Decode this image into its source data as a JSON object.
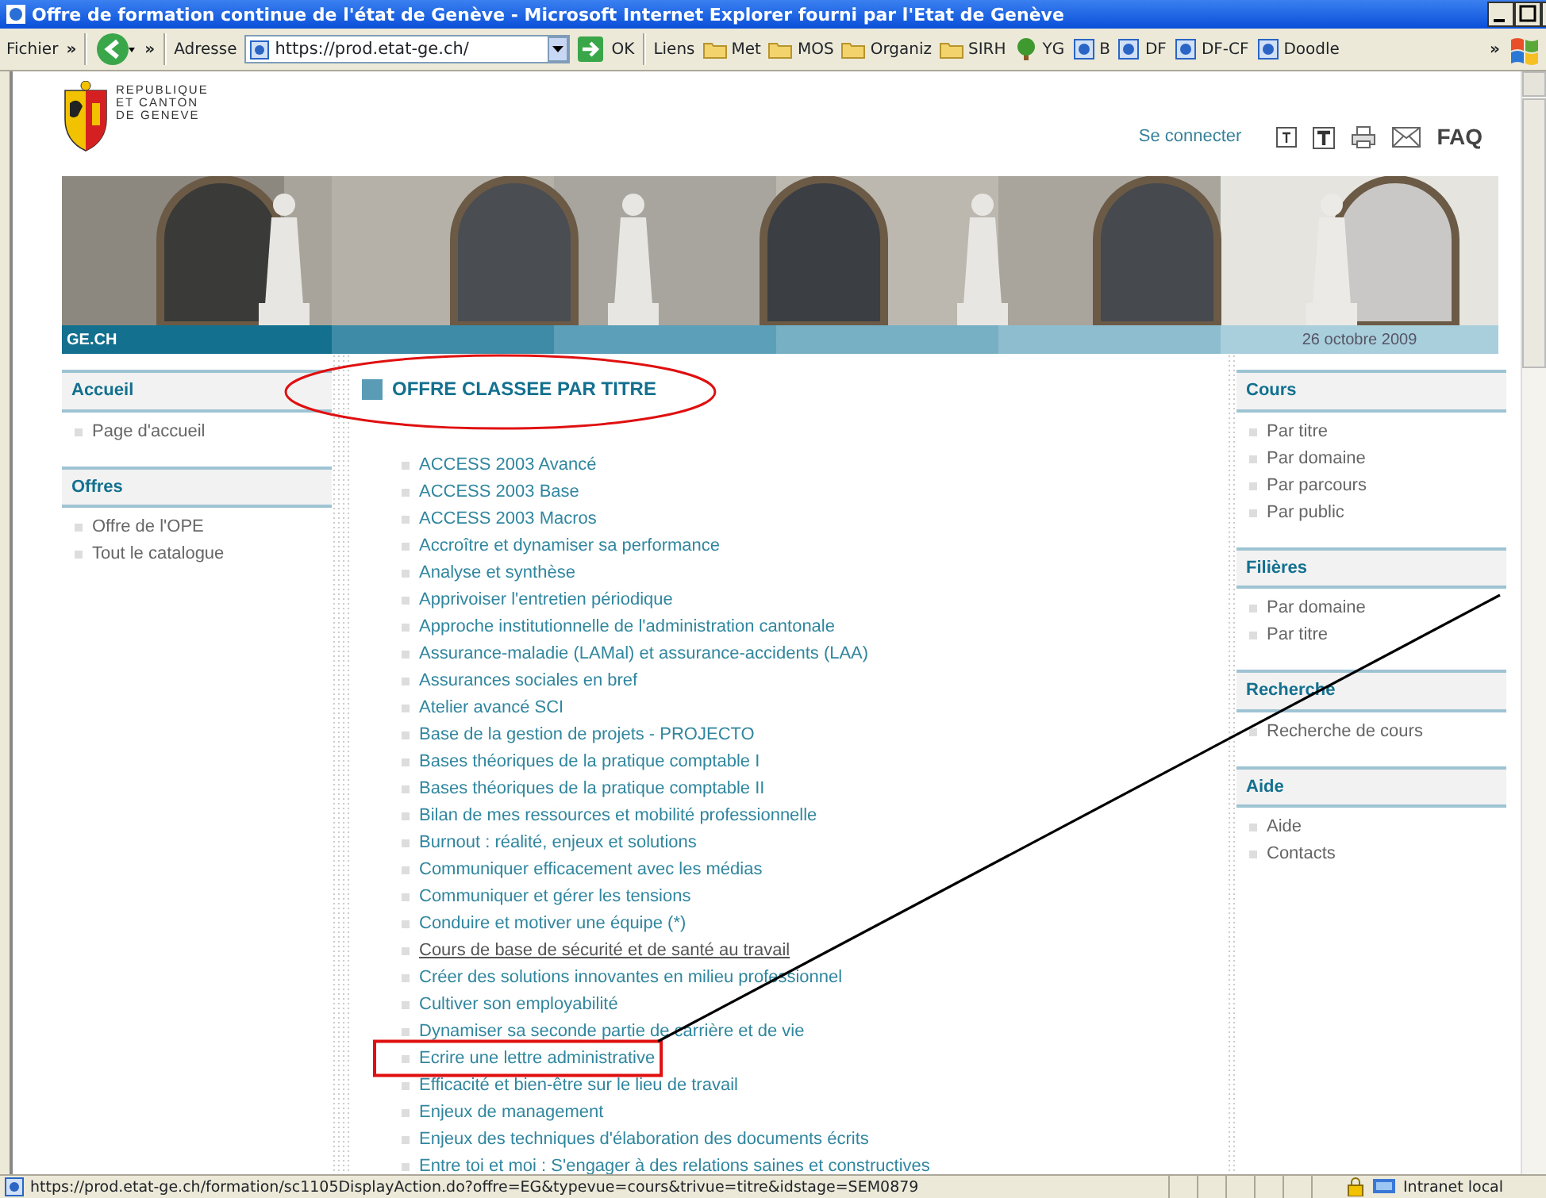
{
  "window": {
    "title": "Offre de formation continue de l'état de Genève - Microsoft Internet Explorer fourni par l'Etat de Genève"
  },
  "toolbar": {
    "menu": "Fichier",
    "chevron": "»",
    "back_chevron": "»",
    "address_label": "Adresse",
    "address": "https://prod.etat-ge.ch/",
    "go": "OK",
    "links_label": "Liens",
    "links": [
      {
        "label": "Met",
        "kind": "folder"
      },
      {
        "label": "MOS",
        "kind": "folder"
      },
      {
        "label": "Organiz",
        "kind": "folder"
      },
      {
        "label": "SIRH",
        "kind": "folder"
      },
      {
        "label": "YG",
        "kind": "tree"
      },
      {
        "label": "B",
        "kind": "page"
      },
      {
        "label": "DF",
        "kind": "page"
      },
      {
        "label": "DF-CF",
        "kind": "page"
      },
      {
        "label": "Doodle",
        "kind": "page"
      }
    ],
    "end_chevron": "»"
  },
  "header": {
    "logo_text": [
      "REPUBLIQUE",
      "ET CANTON",
      "DE GENEVE"
    ],
    "login": "Se connecter",
    "tools": [
      {
        "kind": "text-small"
      },
      {
        "kind": "text-large"
      },
      {
        "kind": "print"
      },
      {
        "kind": "mail"
      },
      {
        "kind": "faq",
        "label": "FAQ"
      }
    ]
  },
  "banner": {
    "kind": "picture",
    "site": "GE.CH",
    "date": "26 octobre 2009"
  },
  "left_sidebar": [
    {
      "title": "Accueil",
      "items": [
        "Page d'accueil"
      ]
    },
    {
      "title": "Offres",
      "items": [
        "Offre de l'OPE",
        "Tout le catalogue"
      ]
    }
  ],
  "main": {
    "heading": "OFFRE CLASSEE PAR TITRE",
    "circled": true,
    "items": [
      {
        "label": "ACCESS 2003 Avancé",
        "hovered": false,
        "boxed": false
      },
      {
        "label": "ACCESS 2003 Base",
        "hovered": false,
        "boxed": false
      },
      {
        "label": "ACCESS 2003 Macros",
        "hovered": false,
        "boxed": false
      },
      {
        "label": "Accroître et dynamiser sa performance",
        "hovered": false,
        "boxed": false
      },
      {
        "label": "Analyse et synthèse",
        "hovered": false,
        "boxed": false
      },
      {
        "label": "Apprivoiser l'entretien périodique",
        "hovered": false,
        "boxed": false
      },
      {
        "label": "Approche institutionnelle de l'administration cantonale",
        "hovered": false,
        "boxed": false
      },
      {
        "label": "Assurance-maladie (LAMal) et assurance-accidents (LAA)",
        "hovered": false,
        "boxed": false
      },
      {
        "label": "Assurances sociales en bref",
        "hovered": false,
        "boxed": false
      },
      {
        "label": "Atelier avancé SCI",
        "hovered": false,
        "boxed": false
      },
      {
        "label": "Base de la gestion de projets - PROJECTO",
        "hovered": false,
        "boxed": false
      },
      {
        "label": "Bases théoriques de la pratique comptable I",
        "hovered": false,
        "boxed": false
      },
      {
        "label": "Bases théoriques de la pratique comptable II",
        "hovered": false,
        "boxed": false
      },
      {
        "label": "Bilan de mes ressources et mobilité professionnelle",
        "hovered": false,
        "boxed": false
      },
      {
        "label": "Burnout : réalité, enjeux et solutions",
        "hovered": false,
        "boxed": false
      },
      {
        "label": "Communiquer efficacement avec les médias",
        "hovered": false,
        "boxed": false
      },
      {
        "label": "Communiquer et gérer les tensions",
        "hovered": false,
        "boxed": false
      },
      {
        "label": "Conduire et motiver une équipe (*)",
        "hovered": false,
        "boxed": false
      },
      {
        "label": "Cours de base de sécurité et de santé au travail",
        "hovered": true,
        "boxed": false
      },
      {
        "label": "Créer des solutions innovantes en milieu professionnel",
        "hovered": false,
        "boxed": false
      },
      {
        "label": "Cultiver son employabilité",
        "hovered": false,
        "boxed": false
      },
      {
        "label": "Dynamiser sa seconde partie de carrière et de vie",
        "hovered": false,
        "boxed": false
      },
      {
        "label": "Ecrire une lettre administrative",
        "hovered": false,
        "boxed": true
      },
      {
        "label": "Efficacité et bien-être sur le lieu de travail",
        "hovered": false,
        "boxed": false
      },
      {
        "label": "Enjeux de management",
        "hovered": false,
        "boxed": false
      },
      {
        "label": "Enjeux des techniques d'élaboration des documents écrits",
        "hovered": false,
        "boxed": false
      },
      {
        "label": "Entre toi et moi : S'engager à des relations saines et constructives",
        "hovered": false,
        "boxed": false
      }
    ]
  },
  "right_sidebar": [
    {
      "title": "Cours",
      "items": [
        "Par titre",
        "Par domaine",
        "Par parcours",
        "Par public"
      ]
    },
    {
      "title": "Filières",
      "items": [
        "Par domaine",
        "Par titre"
      ]
    },
    {
      "title": "Recherche",
      "items": [
        "Recherche de cours"
      ]
    },
    {
      "title": "Aide",
      "items": [
        "Aide",
        "Contacts"
      ]
    }
  ],
  "status_bar": {
    "url": "https://prod.etat-ge.ch/formation/sc1105DisplayAction.do?offre=EG&typevue=cours&trivue=titre&idstage=SEM0879",
    "zone": "Intranet local"
  }
}
